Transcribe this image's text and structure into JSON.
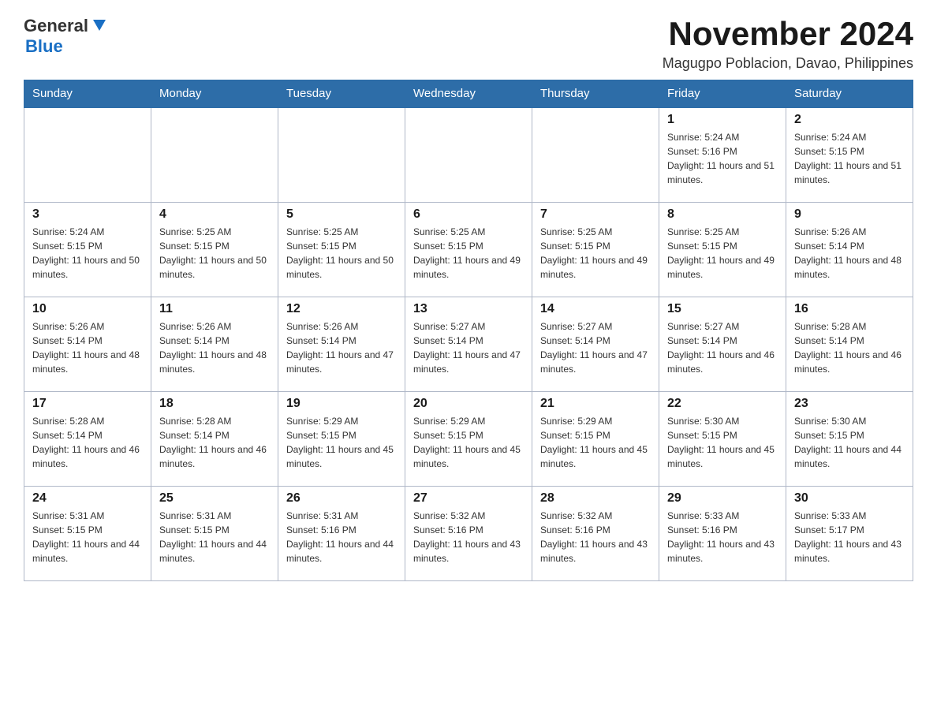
{
  "header": {
    "logo": {
      "general_text": "General",
      "blue_text": "Blue"
    },
    "title": "November 2024",
    "location": "Magugpo Poblacion, Davao, Philippines"
  },
  "calendar": {
    "days_of_week": [
      "Sunday",
      "Monday",
      "Tuesday",
      "Wednesday",
      "Thursday",
      "Friday",
      "Saturday"
    ],
    "weeks": [
      [
        {
          "day": "",
          "sunrise": "",
          "sunset": "",
          "daylight": "",
          "empty": true
        },
        {
          "day": "",
          "sunrise": "",
          "sunset": "",
          "daylight": "",
          "empty": true
        },
        {
          "day": "",
          "sunrise": "",
          "sunset": "",
          "daylight": "",
          "empty": true
        },
        {
          "day": "",
          "sunrise": "",
          "sunset": "",
          "daylight": "",
          "empty": true
        },
        {
          "day": "",
          "sunrise": "",
          "sunset": "",
          "daylight": "",
          "empty": true
        },
        {
          "day": "1",
          "sunrise": "Sunrise: 5:24 AM",
          "sunset": "Sunset: 5:16 PM",
          "daylight": "Daylight: 11 hours and 51 minutes.",
          "empty": false
        },
        {
          "day": "2",
          "sunrise": "Sunrise: 5:24 AM",
          "sunset": "Sunset: 5:15 PM",
          "daylight": "Daylight: 11 hours and 51 minutes.",
          "empty": false
        }
      ],
      [
        {
          "day": "3",
          "sunrise": "Sunrise: 5:24 AM",
          "sunset": "Sunset: 5:15 PM",
          "daylight": "Daylight: 11 hours and 50 minutes.",
          "empty": false
        },
        {
          "day": "4",
          "sunrise": "Sunrise: 5:25 AM",
          "sunset": "Sunset: 5:15 PM",
          "daylight": "Daylight: 11 hours and 50 minutes.",
          "empty": false
        },
        {
          "day": "5",
          "sunrise": "Sunrise: 5:25 AM",
          "sunset": "Sunset: 5:15 PM",
          "daylight": "Daylight: 11 hours and 50 minutes.",
          "empty": false
        },
        {
          "day": "6",
          "sunrise": "Sunrise: 5:25 AM",
          "sunset": "Sunset: 5:15 PM",
          "daylight": "Daylight: 11 hours and 49 minutes.",
          "empty": false
        },
        {
          "day": "7",
          "sunrise": "Sunrise: 5:25 AM",
          "sunset": "Sunset: 5:15 PM",
          "daylight": "Daylight: 11 hours and 49 minutes.",
          "empty": false
        },
        {
          "day": "8",
          "sunrise": "Sunrise: 5:25 AM",
          "sunset": "Sunset: 5:15 PM",
          "daylight": "Daylight: 11 hours and 49 minutes.",
          "empty": false
        },
        {
          "day": "9",
          "sunrise": "Sunrise: 5:26 AM",
          "sunset": "Sunset: 5:14 PM",
          "daylight": "Daylight: 11 hours and 48 minutes.",
          "empty": false
        }
      ],
      [
        {
          "day": "10",
          "sunrise": "Sunrise: 5:26 AM",
          "sunset": "Sunset: 5:14 PM",
          "daylight": "Daylight: 11 hours and 48 minutes.",
          "empty": false
        },
        {
          "day": "11",
          "sunrise": "Sunrise: 5:26 AM",
          "sunset": "Sunset: 5:14 PM",
          "daylight": "Daylight: 11 hours and 48 minutes.",
          "empty": false
        },
        {
          "day": "12",
          "sunrise": "Sunrise: 5:26 AM",
          "sunset": "Sunset: 5:14 PM",
          "daylight": "Daylight: 11 hours and 47 minutes.",
          "empty": false
        },
        {
          "day": "13",
          "sunrise": "Sunrise: 5:27 AM",
          "sunset": "Sunset: 5:14 PM",
          "daylight": "Daylight: 11 hours and 47 minutes.",
          "empty": false
        },
        {
          "day": "14",
          "sunrise": "Sunrise: 5:27 AM",
          "sunset": "Sunset: 5:14 PM",
          "daylight": "Daylight: 11 hours and 47 minutes.",
          "empty": false
        },
        {
          "day": "15",
          "sunrise": "Sunrise: 5:27 AM",
          "sunset": "Sunset: 5:14 PM",
          "daylight": "Daylight: 11 hours and 46 minutes.",
          "empty": false
        },
        {
          "day": "16",
          "sunrise": "Sunrise: 5:28 AM",
          "sunset": "Sunset: 5:14 PM",
          "daylight": "Daylight: 11 hours and 46 minutes.",
          "empty": false
        }
      ],
      [
        {
          "day": "17",
          "sunrise": "Sunrise: 5:28 AM",
          "sunset": "Sunset: 5:14 PM",
          "daylight": "Daylight: 11 hours and 46 minutes.",
          "empty": false
        },
        {
          "day": "18",
          "sunrise": "Sunrise: 5:28 AM",
          "sunset": "Sunset: 5:14 PM",
          "daylight": "Daylight: 11 hours and 46 minutes.",
          "empty": false
        },
        {
          "day": "19",
          "sunrise": "Sunrise: 5:29 AM",
          "sunset": "Sunset: 5:15 PM",
          "daylight": "Daylight: 11 hours and 45 minutes.",
          "empty": false
        },
        {
          "day": "20",
          "sunrise": "Sunrise: 5:29 AM",
          "sunset": "Sunset: 5:15 PM",
          "daylight": "Daylight: 11 hours and 45 minutes.",
          "empty": false
        },
        {
          "day": "21",
          "sunrise": "Sunrise: 5:29 AM",
          "sunset": "Sunset: 5:15 PM",
          "daylight": "Daylight: 11 hours and 45 minutes.",
          "empty": false
        },
        {
          "day": "22",
          "sunrise": "Sunrise: 5:30 AM",
          "sunset": "Sunset: 5:15 PM",
          "daylight": "Daylight: 11 hours and 45 minutes.",
          "empty": false
        },
        {
          "day": "23",
          "sunrise": "Sunrise: 5:30 AM",
          "sunset": "Sunset: 5:15 PM",
          "daylight": "Daylight: 11 hours and 44 minutes.",
          "empty": false
        }
      ],
      [
        {
          "day": "24",
          "sunrise": "Sunrise: 5:31 AM",
          "sunset": "Sunset: 5:15 PM",
          "daylight": "Daylight: 11 hours and 44 minutes.",
          "empty": false
        },
        {
          "day": "25",
          "sunrise": "Sunrise: 5:31 AM",
          "sunset": "Sunset: 5:15 PM",
          "daylight": "Daylight: 11 hours and 44 minutes.",
          "empty": false
        },
        {
          "day": "26",
          "sunrise": "Sunrise: 5:31 AM",
          "sunset": "Sunset: 5:16 PM",
          "daylight": "Daylight: 11 hours and 44 minutes.",
          "empty": false
        },
        {
          "day": "27",
          "sunrise": "Sunrise: 5:32 AM",
          "sunset": "Sunset: 5:16 PM",
          "daylight": "Daylight: 11 hours and 43 minutes.",
          "empty": false
        },
        {
          "day": "28",
          "sunrise": "Sunrise: 5:32 AM",
          "sunset": "Sunset: 5:16 PM",
          "daylight": "Daylight: 11 hours and 43 minutes.",
          "empty": false
        },
        {
          "day": "29",
          "sunrise": "Sunrise: 5:33 AM",
          "sunset": "Sunset: 5:16 PM",
          "daylight": "Daylight: 11 hours and 43 minutes.",
          "empty": false
        },
        {
          "day": "30",
          "sunrise": "Sunrise: 5:33 AM",
          "sunset": "Sunset: 5:17 PM",
          "daylight": "Daylight: 11 hours and 43 minutes.",
          "empty": false
        }
      ]
    ]
  }
}
